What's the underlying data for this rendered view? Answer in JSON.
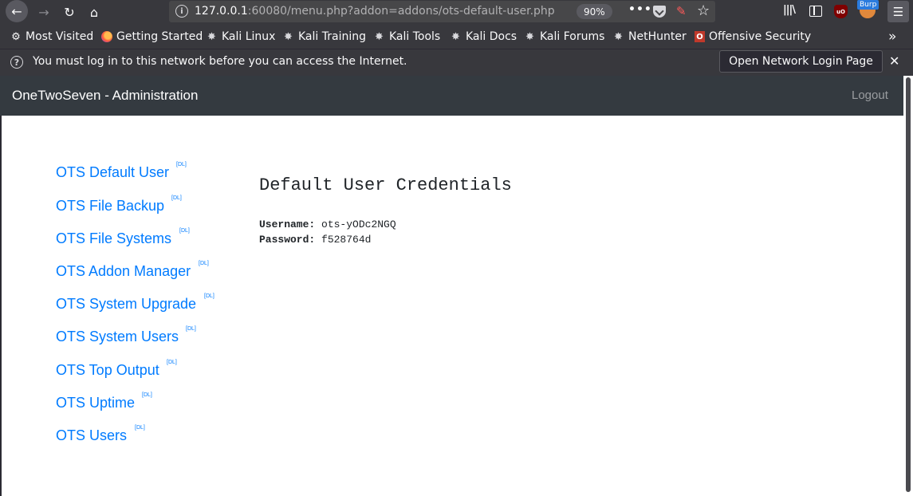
{
  "browser": {
    "url_host": "127.0.0.1",
    "url_rest": ":60080/menu.php?addon=addons/ots-default-user.php",
    "zoom": "90%",
    "url_more": "•••",
    "burp_label": "Burp",
    "ublock_label": "uO"
  },
  "bookmarks": [
    {
      "label": "Most Visited",
      "icon": "gear-icon"
    },
    {
      "label": "Getting Started",
      "icon": "firefox-icon"
    },
    {
      "label": "Kali Linux",
      "icon": "kali-icon"
    },
    {
      "label": "Kali Training",
      "icon": "kali-icon"
    },
    {
      "label": "Kali Tools",
      "icon": "kali-icon"
    },
    {
      "label": "Kali Docs",
      "icon": "kali-icon"
    },
    {
      "label": "Kali Forums",
      "icon": "kali-icon"
    },
    {
      "label": "NetHunter",
      "icon": "kali-icon"
    },
    {
      "label": "Offensive Security",
      "icon": "offsec-icon"
    }
  ],
  "notification": {
    "message": "You must log in to this network before you can access the Internet.",
    "button_label": "Open Network Login Page"
  },
  "header": {
    "brand": "OneTwoSeven - Administration",
    "logout_label": "Logout"
  },
  "menu": {
    "dl_label": "[DL]",
    "items": [
      {
        "label": "OTS Default User"
      },
      {
        "label": "OTS File Backup"
      },
      {
        "label": "OTS File Systems"
      },
      {
        "label": "OTS Addon Manager"
      },
      {
        "label": "OTS System Upgrade"
      },
      {
        "label": "OTS System Users"
      },
      {
        "label": "OTS Top Output"
      },
      {
        "label": "OTS Uptime"
      },
      {
        "label": "OTS Users"
      }
    ]
  },
  "credentials": {
    "title": "Default User Credentials",
    "username_label": "Username:",
    "username_value": "ots-yODc2NGQ",
    "password_label": "Password:",
    "password_value": "f528764d"
  },
  "colors": {
    "link": "#007bff",
    "header_bg": "#343a40",
    "browser_chrome": "#38383d"
  }
}
